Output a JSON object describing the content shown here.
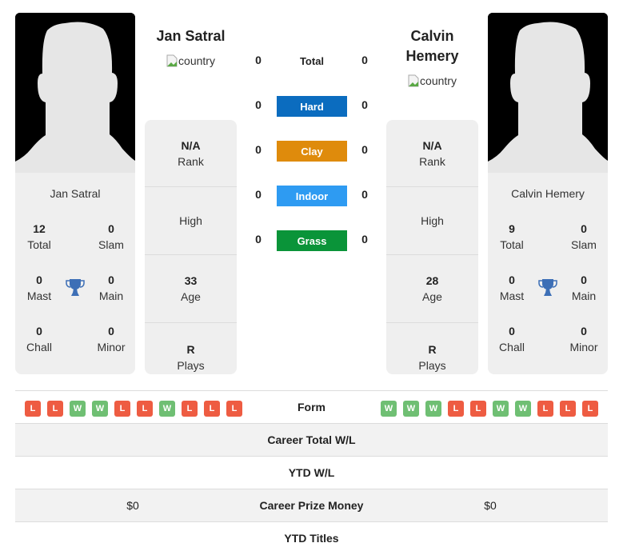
{
  "players": [
    {
      "name": "Jan Satral",
      "country_alt": "country",
      "titles": {
        "total": {
          "value": "12",
          "label": "Total"
        },
        "slam": {
          "value": "0",
          "label": "Slam"
        },
        "mast": {
          "value": "0",
          "label": "Mast"
        },
        "main": {
          "value": "0",
          "label": "Main"
        },
        "chall": {
          "value": "0",
          "label": "Chall"
        },
        "minor": {
          "value": "0",
          "label": "Minor"
        }
      },
      "info": {
        "rank": {
          "value": "N/A",
          "label": "Rank"
        },
        "high": {
          "value": "",
          "label": "High"
        },
        "age": {
          "value": "33",
          "label": "Age"
        },
        "plays": {
          "value": "R",
          "label": "Plays"
        }
      },
      "form": [
        "L",
        "L",
        "W",
        "W",
        "L",
        "L",
        "W",
        "L",
        "L",
        "L"
      ],
      "career_total_wl": "",
      "ytd_wl": "",
      "career_prize_money": "$0",
      "ytd_titles": ""
    },
    {
      "name": "Calvin Hemery",
      "country_alt": "country",
      "titles": {
        "total": {
          "value": "9",
          "label": "Total"
        },
        "slam": {
          "value": "0",
          "label": "Slam"
        },
        "mast": {
          "value": "0",
          "label": "Mast"
        },
        "main": {
          "value": "0",
          "label": "Main"
        },
        "chall": {
          "value": "0",
          "label": "Chall"
        },
        "minor": {
          "value": "0",
          "label": "Minor"
        }
      },
      "info": {
        "rank": {
          "value": "N/A",
          "label": "Rank"
        },
        "high": {
          "value": "",
          "label": "High"
        },
        "age": {
          "value": "28",
          "label": "Age"
        },
        "plays": {
          "value": "R",
          "label": "Plays"
        }
      },
      "form": [
        "W",
        "W",
        "W",
        "L",
        "L",
        "W",
        "W",
        "L",
        "L",
        "L"
      ],
      "career_total_wl": "",
      "ytd_wl": "",
      "career_prize_money": "$0",
      "ytd_titles": ""
    }
  ],
  "h2h": {
    "total": {
      "label": "Total",
      "left": "0",
      "right": "0"
    },
    "surfaces": [
      {
        "label": "Hard",
        "left": "0",
        "right": "0",
        "color": "#0b6cbf"
      },
      {
        "label": "Clay",
        "left": "0",
        "right": "0",
        "color": "#df8b0c"
      },
      {
        "label": "Indoor",
        "left": "0",
        "right": "0",
        "color": "#2e9bf2"
      },
      {
        "label": "Grass",
        "left": "0",
        "right": "0",
        "color": "#0a9439"
      }
    ]
  },
  "table": {
    "form_label": "Form",
    "career_total_wl_label": "Career Total W/L",
    "ytd_wl_label": "YTD W/L",
    "career_prize_money_label": "Career Prize Money",
    "ytd_titles_label": "YTD Titles"
  },
  "icons": {
    "trophy": "trophy-icon",
    "avatar": "silhouette-avatar",
    "broken_image": "broken-image-icon"
  }
}
